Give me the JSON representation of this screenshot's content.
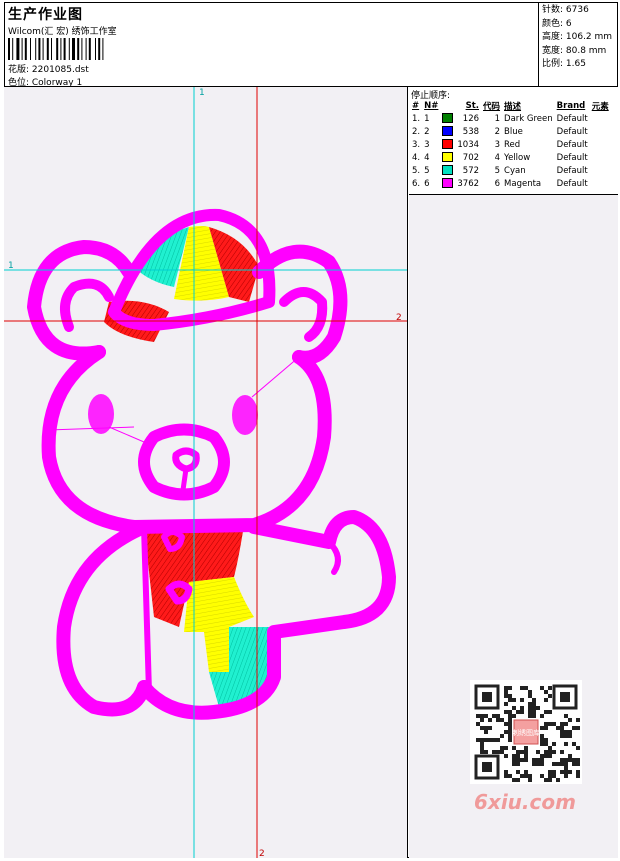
{
  "header": {
    "title": "生产作业图",
    "subtitle": "Wilcom(汇 宏) 绣饰工作室",
    "design_label": "花版: 2201085.dst",
    "color_label": "色位: Colorway 1"
  },
  "stats": {
    "stitches": "针数: 6736",
    "colors": "颜色: 6",
    "height": "高度: 106.2 mm",
    "width": "宽度: 80.8 mm",
    "ratio": "比例: 1.65"
  },
  "sequence": {
    "title": "停止顺序:",
    "headers": [
      "#",
      "N#",
      "St.",
      "代码",
      "描述",
      "Brand",
      "元素"
    ],
    "rows": [
      {
        "num": "1.",
        "n": "1",
        "color": "#008000",
        "st": "126",
        "code": "1",
        "desc": "Dark Green",
        "brand": "Default"
      },
      {
        "num": "2.",
        "n": "2",
        "color": "#0000ff",
        "st": "538",
        "code": "2",
        "desc": "Blue",
        "brand": "Default"
      },
      {
        "num": "3.",
        "n": "3",
        "color": "#ff0000",
        "st": "1034",
        "code": "3",
        "desc": "Red",
        "brand": "Default"
      },
      {
        "num": "4.",
        "n": "4",
        "color": "#ffff00",
        "st": "702",
        "code": "4",
        "desc": "Yellow",
        "brand": "Default"
      },
      {
        "num": "5.",
        "n": "5",
        "color": "#00e0c0",
        "st": "572",
        "code": "5",
        "desc": "Cyan",
        "brand": "Default"
      },
      {
        "num": "6.",
        "n": "6",
        "color": "#ff00ff",
        "st": "3762",
        "code": "6",
        "desc": "Magenta",
        "brand": "Default"
      }
    ]
  },
  "canvas": {
    "guide_labels": {
      "top_cyan": "1",
      "left_cyan": "1",
      "right_red": "2",
      "bottom_red": "2"
    }
  },
  "watermark": {
    "text": "6xiu.com",
    "qr_caption": "刺绣图库"
  },
  "colors": {
    "magenta": "#ff00ff",
    "red": "#ff0000",
    "yellow": "#ffff00",
    "cyan": "#00e0c0",
    "guide_cyan": "#00d0d0",
    "guide_red": "#e00000"
  }
}
